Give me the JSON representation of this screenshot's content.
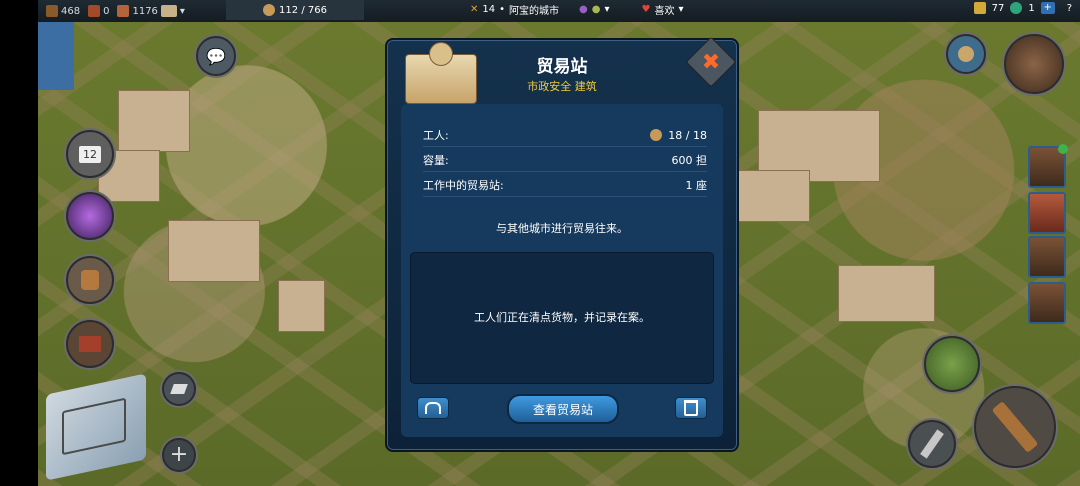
{
  "topbar": {
    "resource1": "468",
    "resource2": "0",
    "resource3": "1176",
    "population": "112 / 766",
    "city_level": "14",
    "city_name": "阿宝的城市",
    "likes": "喜欢",
    "gold": "77",
    "gems": "1",
    "plus": "+",
    "help": "?"
  },
  "dialog": {
    "title": "贸易站",
    "subtitle": "市政安全 建筑",
    "rows": [
      {
        "label": "工人:",
        "value": "18 / 18"
      },
      {
        "label": "容量:",
        "value": "600 担"
      },
      {
        "label": "工作中的贸易站:",
        "value": "1 座"
      }
    ],
    "description": "与其他城市进行贸易往来。",
    "status_text": "工人们正在清点货物，并记录在案。",
    "main_button": "查看贸易站",
    "close_glyph": "✖"
  },
  "left_buttons": {
    "calendar_day": "12"
  },
  "colors": {
    "accent": "#f0cc38",
    "panel": "#163a5d",
    "button": "#2f7fc4"
  }
}
